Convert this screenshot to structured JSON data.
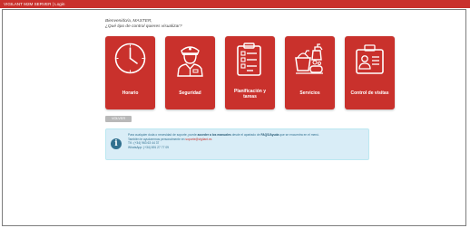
{
  "app": {
    "title": "VIGILANT M2M SERVER | Login",
    "brand_color": "#c9302c"
  },
  "greeting": {
    "line1": "Bienvenido/a, MASTER,",
    "line2": "¿Qué tipo de control quieres visualizar?"
  },
  "tiles": [
    {
      "label": "Horario",
      "icon": "clock-icon"
    },
    {
      "label": "Seguridad",
      "icon": "security-guard-icon"
    },
    {
      "label": "Planificación y tareas",
      "icon": "clipboard-checklist-icon"
    },
    {
      "label": "Servicios",
      "icon": "cleaning-supplies-icon"
    },
    {
      "label": "Control de visitas",
      "icon": "id-card-icon"
    }
  ],
  "volver_button": {
    "label": "VOLVER"
  },
  "info": {
    "icon": "info-icon",
    "part1": "Para cualquier duda o necesidad de soporte, puede ",
    "bold1": "acceder a los manuales",
    "part2": " desde el apartado de ",
    "bold2": "FAQS/Ayuda",
    "part3": " que se encuentra en el menú.",
    "line2_prefix": "También te ayudaremos personalmente en ",
    "email": "soporte@vigilant.es",
    "phone": "Tlf.: (+34) 963 63 44 37",
    "whatsapp": "WhatsApp: (+34) 691 27 77 09",
    "bg_color": "#d9edf7"
  }
}
